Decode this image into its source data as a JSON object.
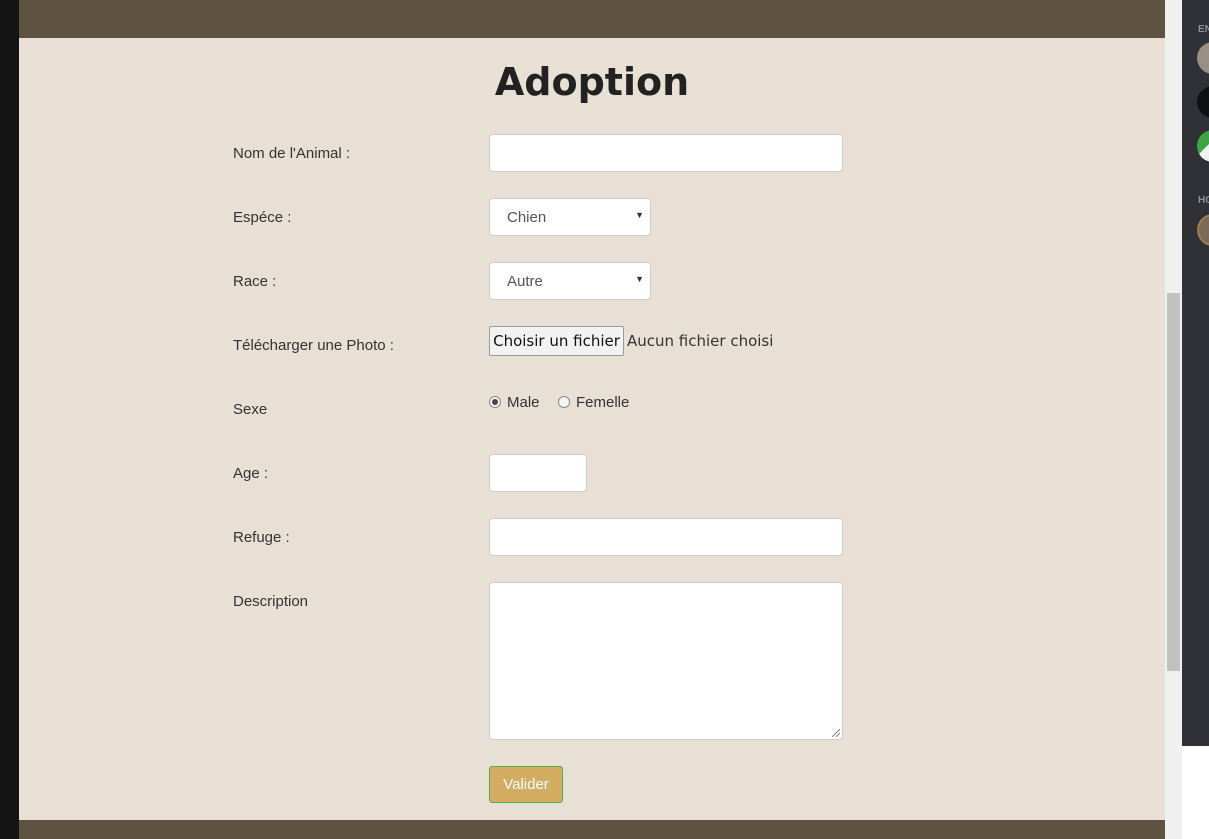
{
  "page_title": "Adoption",
  "fields": {
    "nom_label": "Nom de l'Animal :",
    "nom_value": "",
    "espece_label": "Espéce :",
    "espece_value": "Chien",
    "race_label": "Race :",
    "race_value": "Autre",
    "photo_label": "Télécharger une Photo :",
    "photo_button": "Choisir un fichier",
    "photo_status": "Aucun fichier choisi",
    "sexe_label": "Sexe",
    "sexe_options": [
      "Male",
      "Femelle"
    ],
    "sexe_selected": "Male",
    "age_label": "Age :",
    "age_value": "",
    "refuge_label": "Refuge :",
    "refuge_value": "",
    "description_label": "Description",
    "description_value": ""
  },
  "submit_label": "Valider",
  "side_panel": {
    "header_1": "EN",
    "header_2": "HO"
  },
  "colors": {
    "bar": "#5e5241",
    "background": "#e8dfd5",
    "submit": "#d4ad62"
  }
}
